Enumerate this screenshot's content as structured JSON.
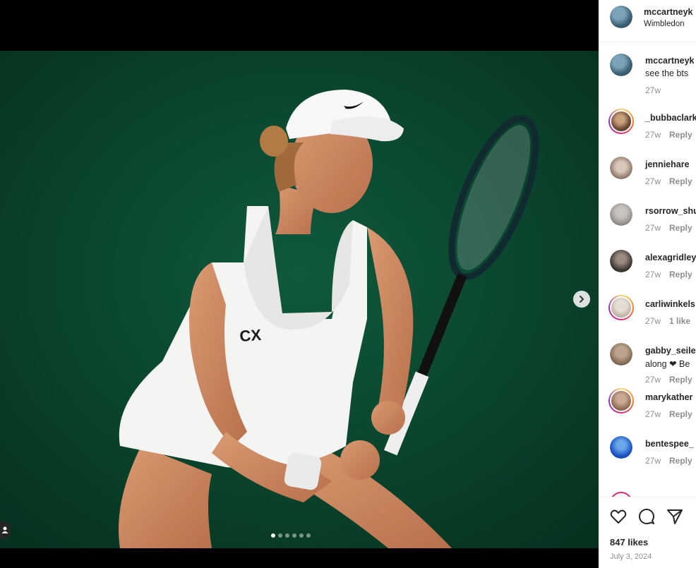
{
  "post": {
    "username": "mccartneyk",
    "location": "Wimbledon",
    "likes": "847 likes",
    "date": "July 3, 2024"
  },
  "carousel": {
    "slides": 6,
    "active_index": 0,
    "next_icon": "chevron-right-icon",
    "tag_icon": "person-icon"
  },
  "caption": {
    "username": "mccartneyk",
    "text": "see the bts",
    "time": "27w"
  },
  "comments": [
    {
      "username": "_bubbaclark",
      "text": "",
      "time": "27w",
      "action": "Reply",
      "story_ring": true
    },
    {
      "username": "jenniehare",
      "text": "",
      "time": "27w",
      "action": "Reply",
      "story_ring": false
    },
    {
      "username": "rsorrow_shu",
      "text": "",
      "time": "27w",
      "action": "Reply",
      "story_ring": false
    },
    {
      "username": "alexagridley",
      "text": "",
      "time": "27w",
      "action": "Reply",
      "story_ring": false
    },
    {
      "username": "carliwinkels",
      "text": "",
      "time": "27w",
      "action": "1 like",
      "story_ring": true
    },
    {
      "username": "gabby_seile",
      "text": "along ❤ Be",
      "time": "27w",
      "action": "Reply",
      "story_ring": false
    },
    {
      "username": "marykather",
      "text": "",
      "time": "27w",
      "action": "Reply",
      "story_ring": true
    },
    {
      "username": "bentespee_",
      "text": "",
      "time": "27w",
      "action": "Reply",
      "story_ring": false
    }
  ],
  "actions": {
    "like_icon": "heart-icon",
    "comment_icon": "comment-icon",
    "share_icon": "share-icon"
  }
}
